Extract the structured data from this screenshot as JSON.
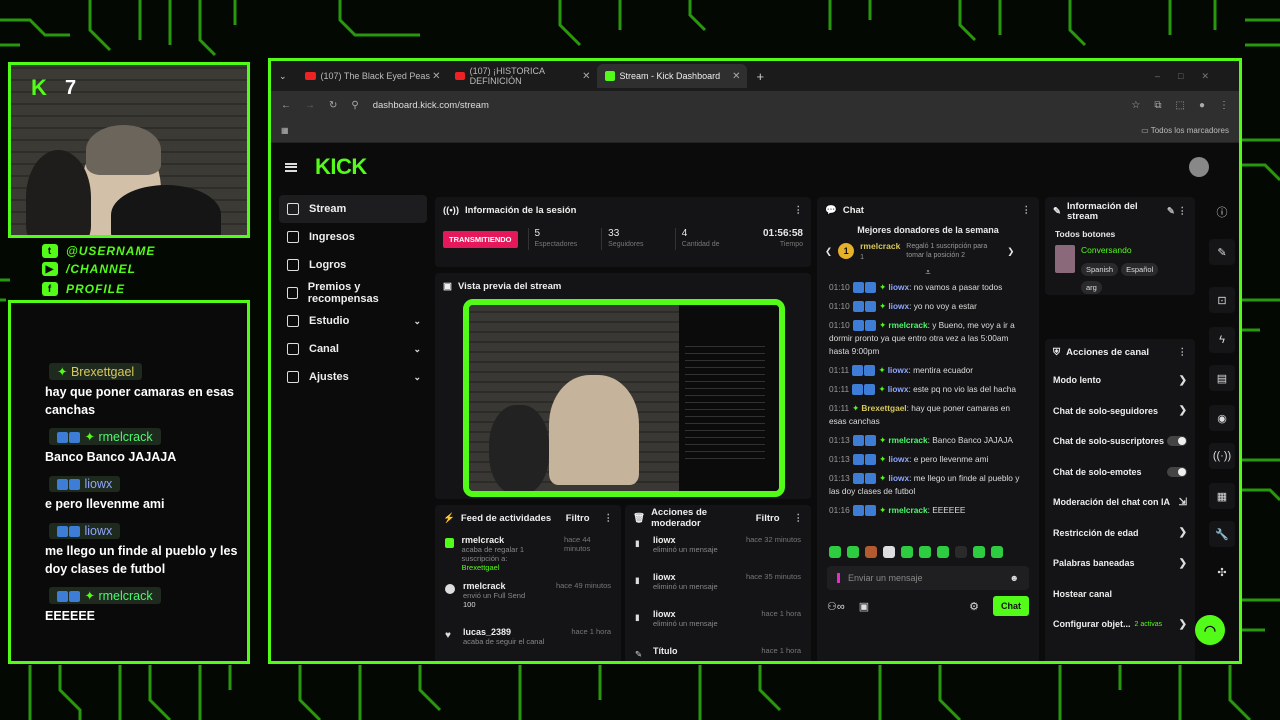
{
  "webcam": {
    "logo": "K",
    "number": "7"
  },
  "socials": [
    {
      "icon": "twitter-icon",
      "glyph": "t",
      "label": "@USERNAME"
    },
    {
      "icon": "youtube-icon",
      "glyph": "▶",
      "label": "/CHANNEL"
    },
    {
      "icon": "facebook-icon",
      "glyph": "f",
      "label": "PROFILE"
    }
  ],
  "overlay_chat": [
    {
      "user": "Brexettgael",
      "msg": "hay que poner camaras en esas canchas"
    },
    {
      "user": "rmelcrack",
      "msg": "Banco Banco JAJAJA"
    },
    {
      "user": "liowx",
      "msg": "e pero llevenme ami"
    },
    {
      "user": "liowx",
      "msg": "me llego un finde al pueblo y les doy clases de futbol"
    },
    {
      "user": "rmelcrack",
      "msg": "EEEEEE"
    }
  ],
  "browser": {
    "tabs": [
      {
        "label": "(107) The Black Eyed Peas"
      },
      {
        "label": "(107) ¡HISTORICA DEFINICIÓN"
      },
      {
        "label": "Stream - Kick Dashboard"
      }
    ],
    "url": "dashboard.kick.com/stream",
    "bookmarks_label": "Todos los marcadores"
  },
  "kick": {
    "logo": "KICK",
    "sidebar": [
      {
        "label": "Stream",
        "name": "sidebar-item-stream"
      },
      {
        "label": "Ingresos",
        "name": "sidebar-item-ingresos"
      },
      {
        "label": "Logros",
        "name": "sidebar-item-logros"
      },
      {
        "label": "Premios y recompensas",
        "name": "sidebar-item-premios"
      },
      {
        "label": "Estudio",
        "name": "sidebar-item-estudio"
      },
      {
        "label": "Canal",
        "name": "sidebar-item-canal"
      },
      {
        "label": "Ajustes",
        "name": "sidebar-item-ajustes"
      }
    ],
    "session": {
      "title": "Información de la sesión",
      "live": "TRANSMITIENDO",
      "stats": [
        {
          "value": "5",
          "label": "Espectadores"
        },
        {
          "value": "33",
          "label": "Seguidores"
        },
        {
          "value": "4",
          "label": "Cantidad de"
        }
      ],
      "time": {
        "value": "01:56:58",
        "label": "Tiempo"
      }
    },
    "preview_title": "Vista previa del stream",
    "feed": {
      "title": "Feed de actividades",
      "filter": "Filtro",
      "items": [
        {
          "user": "rmelcrack",
          "time": "hace 44 minutos",
          "text": "acaba de regalar 1 suscripción a:",
          "extra": "Brexettgael"
        },
        {
          "user": "rmelcrack",
          "time": "hace 49 minutos",
          "text": "envió un Full Send",
          "extra": "100"
        },
        {
          "user": "lucas_2389",
          "time": "hace 1 hora",
          "text": "acaba de seguir el canal",
          "extra": ""
        }
      ]
    },
    "mod": {
      "title": "Acciones de moderador",
      "filter": "Filtro",
      "items": [
        {
          "user": "liowx",
          "time": "hace 32 minutos",
          "text": "eliminó un mensaje"
        },
        {
          "user": "liowx",
          "time": "hace 35 minutos",
          "text": "eliminó un mensaje"
        },
        {
          "user": "liowx",
          "time": "hace 1 hora",
          "text": "eliminó un mensaje"
        },
        {
          "user": "Título",
          "time": "hace 1 hora",
          "text": ""
        }
      ]
    },
    "chat": {
      "title": "Chat",
      "donors_title": "Mejores donadores de la semana",
      "donor_rank": "1",
      "donor_name": "rmelcrack",
      "donor_count": "1",
      "donor_note": "Regaló 1 suscripción para tomar la posición 2",
      "lines": [
        {
          "t": "01:10",
          "u": "liowx",
          "c": "b",
          "m": "no vamos a pasar todos"
        },
        {
          "t": "01:10",
          "u": "liowx",
          "c": "b",
          "m": "yo no voy a estar"
        },
        {
          "t": "01:10",
          "u": "rmelcrack",
          "c": "g",
          "m": "y Bueno, me voy a ir a dormir pronto ya que entro otra vez a las 5:00am hasta 9:00pm"
        },
        {
          "t": "01:11",
          "u": "liowx",
          "c": "b",
          "m": "mentira ecuador"
        },
        {
          "t": "01:11",
          "u": "liowx",
          "c": "b",
          "m": "este pq no vio las del hacha"
        },
        {
          "t": "01:11",
          "u": "Brexettgael",
          "c": "y",
          "m": "hay que poner camaras en esas canchas"
        },
        {
          "t": "01:13",
          "u": "rmelcrack",
          "c": "g",
          "m": "Banco Banco JAJAJA"
        },
        {
          "t": "01:13",
          "u": "liowx",
          "c": "b",
          "m": "e pero llevenme ami"
        },
        {
          "t": "01:13",
          "u": "liowx",
          "c": "b",
          "m": "me llego un finde al pueblo y las doy clases de futbol"
        },
        {
          "t": "01:16",
          "u": "rmelcrack",
          "c": "g",
          "m": "EEEEEE"
        }
      ],
      "placeholder": "Enviar un mensaje",
      "send": "Chat"
    },
    "info": {
      "title": "Información del stream",
      "buttons_label": "Todos botones",
      "category": "Conversando",
      "tags": [
        "Spanish",
        "Español",
        "arg"
      ]
    },
    "actions": {
      "title": "Acciones de canal",
      "items": [
        {
          "label": "Modo lento",
          "kind": "arrow"
        },
        {
          "label": "Chat de solo-seguidores",
          "kind": "arrow"
        },
        {
          "label": "Chat de solo-suscriptores",
          "kind": "toggle"
        },
        {
          "label": "Chat de solo-emotes",
          "kind": "toggle"
        },
        {
          "label": "Moderación del chat con IA",
          "kind": "ext"
        },
        {
          "label": "Restricción de edad",
          "kind": "arrow"
        },
        {
          "label": "Palabras baneadas",
          "kind": "arrow"
        },
        {
          "label": "Hostear canal",
          "kind": "none"
        },
        {
          "label": "Configurar objet...",
          "kind": "arrow",
          "extra": "2 activas"
        }
      ]
    }
  },
  "colors": {
    "accent": "#53fc18",
    "live": "#e5185b"
  }
}
